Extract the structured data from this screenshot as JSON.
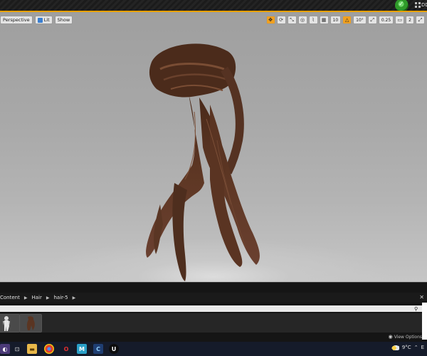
{
  "titlebar": {
    "title_fragment": "DD"
  },
  "viewport": {
    "toolbar_left": [
      {
        "label": "Perspective"
      },
      {
        "label": "Lit"
      },
      {
        "label": "Show"
      }
    ],
    "grid_snap_value": "10",
    "rotation_snap_value": "10°",
    "scale_snap_value": "0.25",
    "camera_speed_value": "2"
  },
  "content_browser": {
    "breadcrumbs": [
      "Content",
      "Hair",
      "hair-5"
    ],
    "view_options_label": "View Options"
  },
  "taskbar": {
    "weather": "9°C",
    "tray_fragment": "E"
  },
  "colors": {
    "accent": "#e8a000",
    "viewport_bg": "#a8a8a8",
    "hair": "#5a3522"
  }
}
